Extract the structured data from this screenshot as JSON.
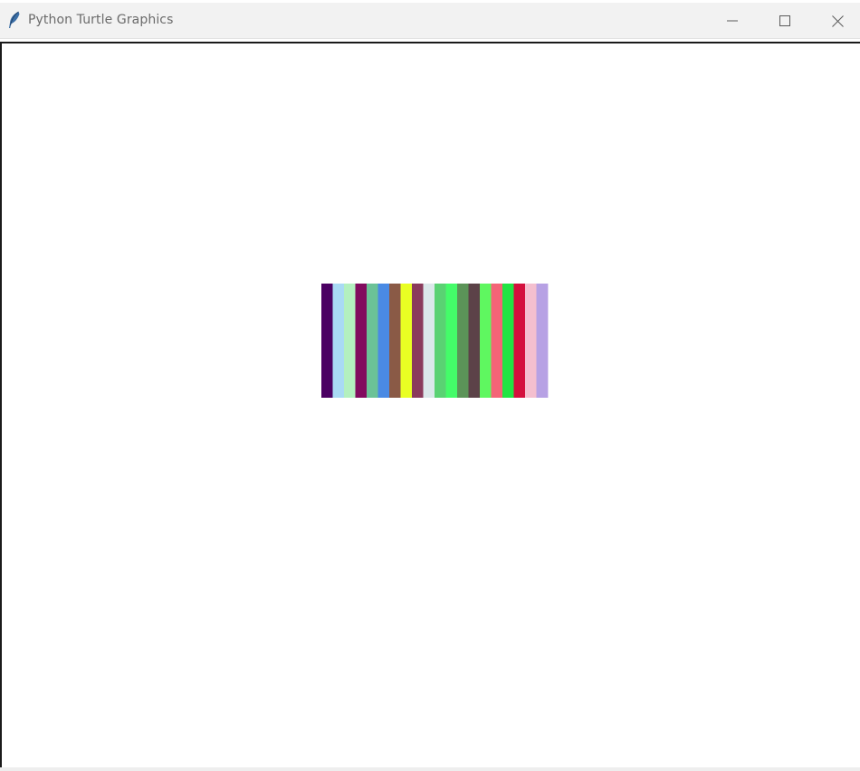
{
  "window": {
    "title": "Python Turtle Graphics",
    "icons": {
      "app": "feather-icon",
      "minimize": "minimize-icon",
      "maximize": "maximize-icon",
      "close": "close-icon"
    }
  },
  "drawing": {
    "bar_colors": [
      "#4b0063",
      "#a9daf4",
      "#b3f0bf",
      "#820b5e",
      "#6bc297",
      "#4a8ae4",
      "#8a5a46",
      "#e9ff23",
      "#8a3b5c",
      "#dbe8ea",
      "#5ad273",
      "#44fc69",
      "#5b9458",
      "#5c4248",
      "#5ff760",
      "#f46477",
      "#22e443",
      "#d4103d",
      "#f4bfcf",
      "#b7a1e4"
    ]
  }
}
